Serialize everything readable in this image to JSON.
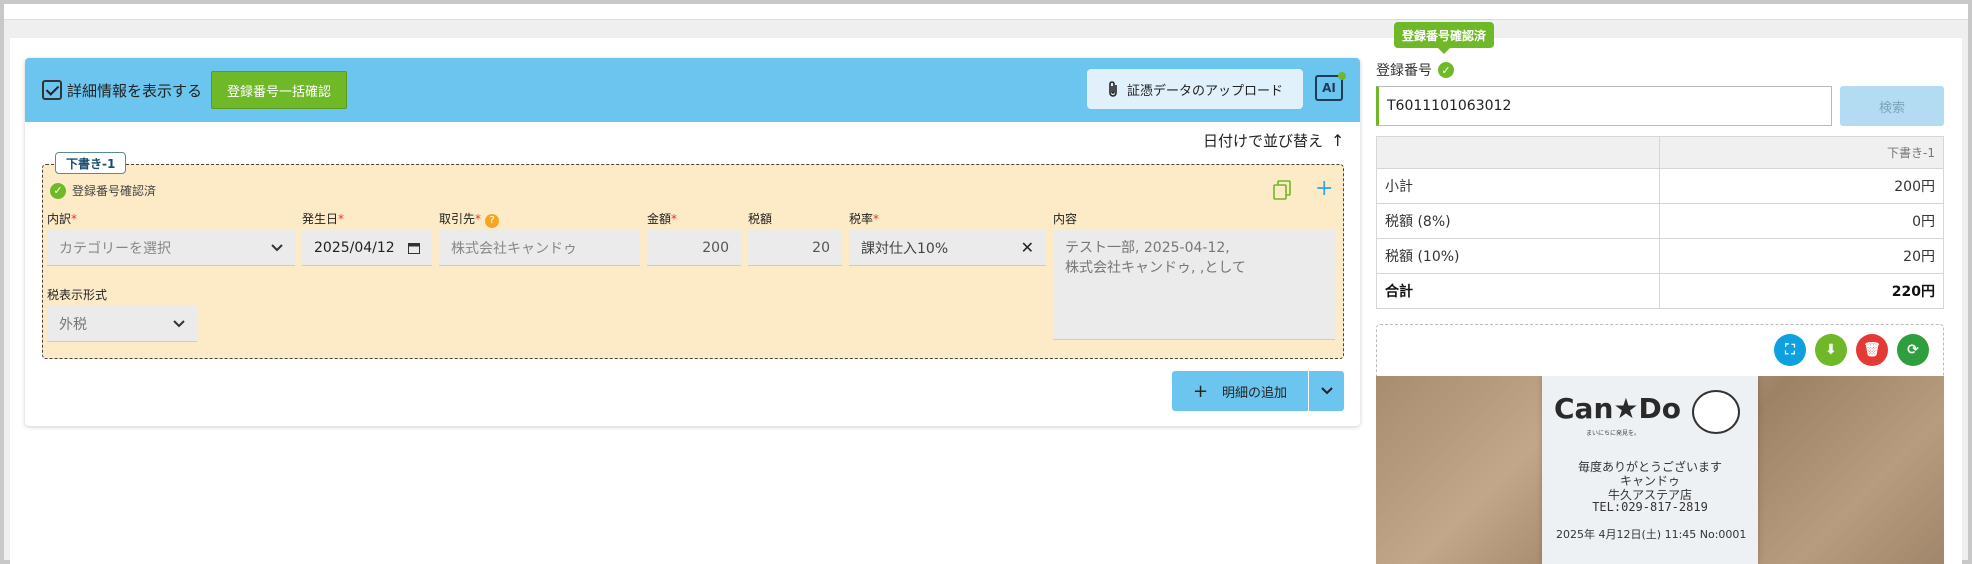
{
  "header": {
    "show_details_label": "詳細情報を表示する",
    "bulk_confirm_label": "登録番号一括確認",
    "upload_label": "証憑データのアップロード",
    "ai_label": "AI"
  },
  "sort_label": "日付けで並び替え",
  "sort_arrow": "↑",
  "draft": {
    "tag": "下書き-1",
    "verified_label": "登録番号確認済",
    "fields": {
      "category_label": "内訳",
      "category_placeholder": "カテゴリーを選択",
      "date_label": "発生日",
      "date_value": "2025/04/12",
      "partner_label": "取引先",
      "partner_placeholder": "株式会社キャンドゥ",
      "amount_label": "金額",
      "amount_value": "200",
      "tax_label": "税額",
      "tax_value": "20",
      "rate_label": "税率",
      "rate_value": "課対仕入10%",
      "content_label": "内容",
      "content_line1": "テスト一部, 2025-04-12,",
      "content_line2": "株式会社キャンドゥ, ,として",
      "tax_display_label": "税表示形式",
      "tax_display_value": "外税"
    },
    "add_label": "明細の追加"
  },
  "right": {
    "badge": "登録番号確認済",
    "reg_label": "登録番号",
    "reg_value": "T6011101063012",
    "search_label": "検索",
    "table": {
      "col": "下書き-1",
      "rows": [
        {
          "label": "小計",
          "value": "200円"
        },
        {
          "label": "税額 (8%)",
          "value": "0円"
        },
        {
          "label": "税額 (10%)",
          "value": "20円"
        },
        {
          "label": "合計",
          "value": "220円"
        }
      ]
    },
    "receipt": {
      "brand": "Can★Do",
      "brand_sub": "まいにちに発見を。",
      "line1": "毎度ありがとうございます",
      "line2": "キャンドゥ",
      "line3": "牛久アステア店",
      "line4": "TEL:029-817-2819",
      "date": "2025年 4月12日(土) 11:45 No:0001"
    }
  },
  "colors": {
    "accent": "#6cc5ef",
    "green": "#6fb827",
    "draft_bg": "#fdebc7"
  }
}
